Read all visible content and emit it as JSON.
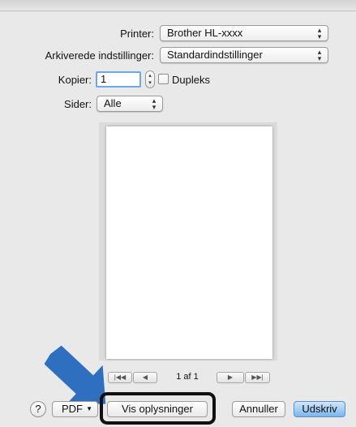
{
  "dialog": {
    "printer_label": "Printer:",
    "printer_value": "Brother HL-xxxx",
    "presets_label": "Arkiverede indstillinger:",
    "presets_value": "Standardindstillinger",
    "copies_label": "Kopier:",
    "copies_value": "1",
    "duplex_label": "Dupleks",
    "duplex_checked": false,
    "pages_label": "Sider:",
    "pages_value": "Alle"
  },
  "preview": {
    "page_indicator": "1 af 1"
  },
  "footer": {
    "help_label": "?",
    "pdf_label": "PDF",
    "show_details_label": "Vis oplysninger",
    "cancel_label": "Annuller",
    "print_label": "Udskriv"
  },
  "colors": {
    "accent": "#7ab6ee",
    "arrow": "#2f6fbf",
    "highlight": "#111111"
  },
  "icons": [
    "up-down-chevron-icon",
    "first-page-icon",
    "prev-page-icon",
    "next-page-icon",
    "last-page-icon",
    "help-icon",
    "arrow-pointer-icon"
  ]
}
